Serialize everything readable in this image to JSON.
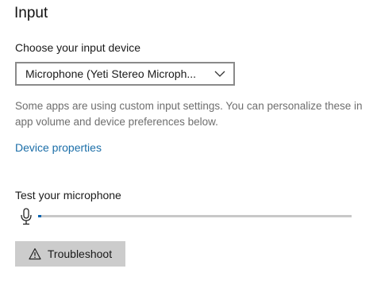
{
  "section": {
    "title": "Input"
  },
  "device": {
    "label": "Choose your input device",
    "selected": "Microphone (Yeti Stereo Microph..."
  },
  "info": {
    "text": "Some apps are using custom input settings. You can personalize these in app volume and device preferences below."
  },
  "links": {
    "device_properties": "Device properties"
  },
  "test": {
    "label": "Test your microphone",
    "level_percent": 1
  },
  "actions": {
    "troubleshoot_label": "Troubleshoot"
  },
  "colors": {
    "accent": "#0063b1",
    "link": "#1b6ea8",
    "button_bg": "#cccccc"
  },
  "icons": {
    "dropdown": "chevron-down-icon",
    "microphone": "microphone-icon",
    "troubleshoot": "warning-icon"
  }
}
